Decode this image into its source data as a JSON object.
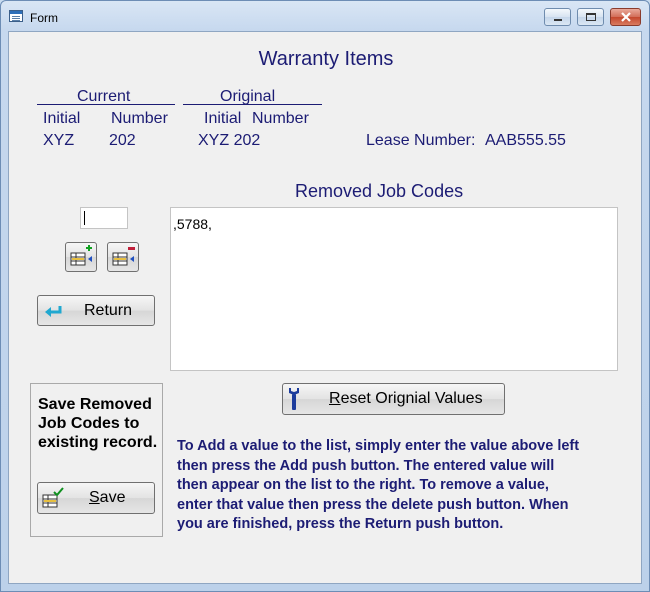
{
  "window": {
    "title": "Form"
  },
  "heading": "Warranty Items",
  "current": {
    "label": "Current",
    "initial_label": "Initial",
    "number_label": "Number",
    "initial": "XYZ",
    "number": "202"
  },
  "original": {
    "label": "Original",
    "initial_label": "Initial",
    "number_label": "Number",
    "value": "XYZ 202"
  },
  "lease": {
    "label": "Lease Number:",
    "value": "AAB555.55"
  },
  "removed": {
    "title": "Removed Job Codes",
    "list_text": ",5788,"
  },
  "entry_value": "",
  "buttons": {
    "return": "Return",
    "reset_mnemonic": "R",
    "reset_rest": "eset Orignial Values",
    "save_mnemonic": "S",
    "save_rest": "ave"
  },
  "save_box": {
    "line1": "Save Removed",
    "line2": "Job Codes to",
    "line3": "existing record."
  },
  "instructions": {
    "line1": "To Add a value to the list, simply enter the value above left",
    "line2": "then press the Add push button.  The entered value will",
    "line3": "then appear on the list to the right.  To remove a value,",
    "line4": "enter that value then press the delete push button.  When",
    "line5": "you are finished, press the Return push button."
  },
  "icons": {
    "app": "form-window-icon",
    "add": "add-row-icon",
    "delete": "delete-row-icon",
    "return": "return-arrow-icon",
    "reset": "wrench-icon",
    "save": "save-check-icon"
  },
  "colors": {
    "label_text": "#1c1c74",
    "window_frame": "#c9dcf0",
    "form_background": "#f0f0f0"
  }
}
